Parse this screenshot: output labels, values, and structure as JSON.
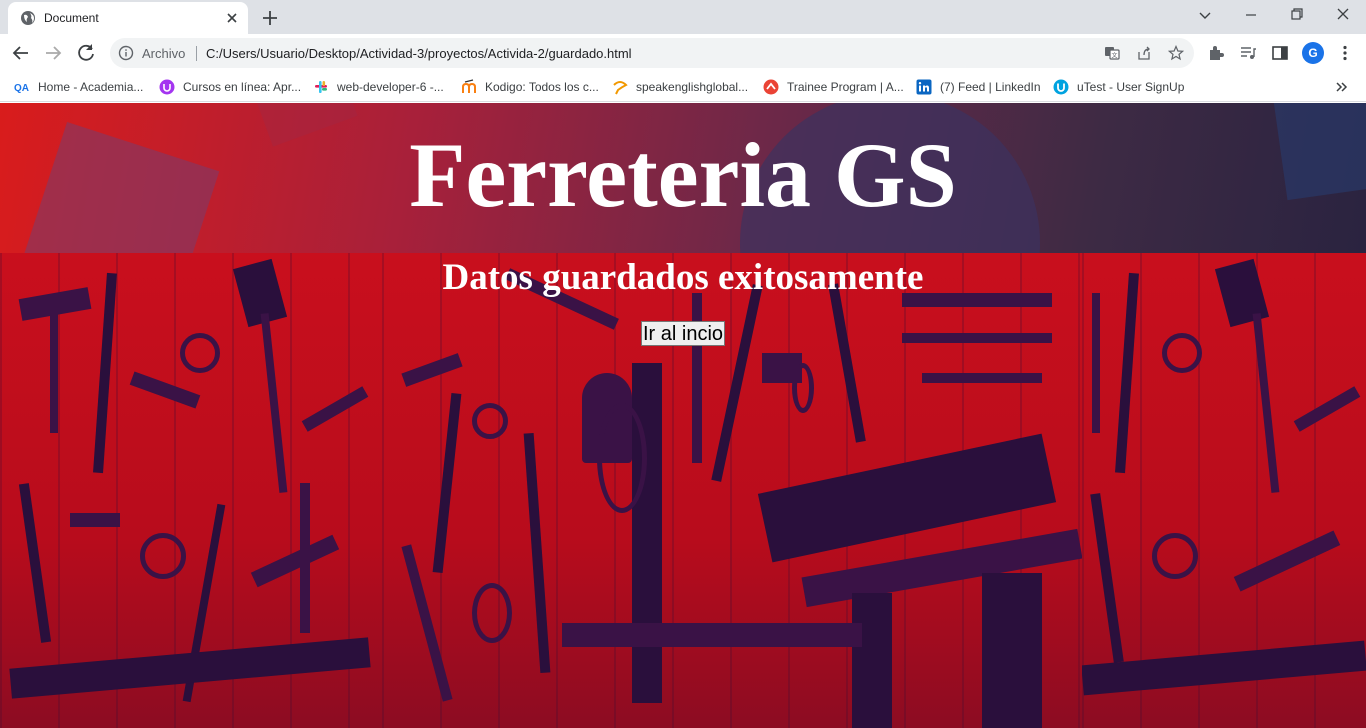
{
  "tab": {
    "title": "Document"
  },
  "omnibox": {
    "scheme_label": "Archivo",
    "url": "C:/Users/Usuario/Desktop/Actividad-3/proyectos/Activida-2/guardado.html"
  },
  "profile": {
    "initial": "G"
  },
  "bookmarks": [
    {
      "label": "Home - Academia...",
      "icon": "qa-icon",
      "color": "#1a73e8"
    },
    {
      "label": "Cursos en línea: Apr...",
      "icon": "udemy-icon",
      "color": "#a435f0"
    },
    {
      "label": "web-developer-6 -...",
      "icon": "slack-icon",
      "color": "#e01e5a"
    },
    {
      "label": "Kodigo: Todos los c...",
      "icon": "moodle-icon",
      "color": "#f98012"
    },
    {
      "label": "speakenglishglobal...",
      "icon": "speak-icon",
      "color": "#f29900"
    },
    {
      "label": "Trainee Program | A...",
      "icon": "trainee-icon",
      "color": "#ea4335"
    },
    {
      "label": "(7) Feed | LinkedIn",
      "icon": "linkedin-icon",
      "color": "#0a66c2"
    },
    {
      "label": "uTest - User SignUp",
      "icon": "utest-icon",
      "color": "#00a3e0"
    }
  ],
  "page": {
    "heading": "Ferreteria GS",
    "message": "Datos guardados exitosamente",
    "button_label": "Ir al incio"
  }
}
